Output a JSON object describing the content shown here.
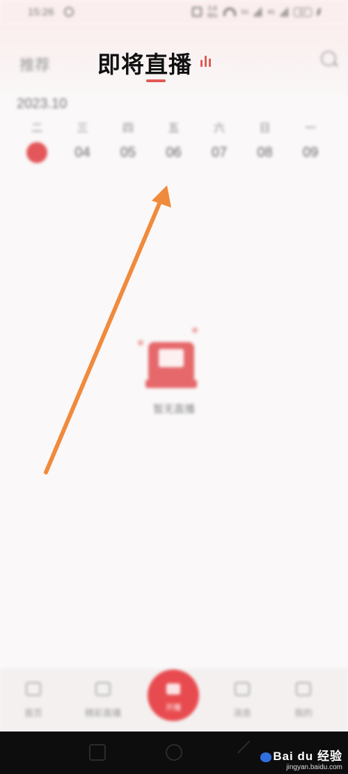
{
  "status_bar": {
    "time": "15:26",
    "net_speed_value": "5.8",
    "net_speed_unit": "M/s",
    "signal1_label": "5G",
    "signal2_label": "4G",
    "battery": "57"
  },
  "tabs": {
    "recommend_label": "推荐",
    "upcoming_label": "即将直播"
  },
  "calendar": {
    "month_label": "2023.10",
    "days": [
      {
        "weekday": "二",
        "date": "",
        "selected": true
      },
      {
        "weekday": "三",
        "date": "04",
        "selected": false
      },
      {
        "weekday": "四",
        "date": "05",
        "selected": false
      },
      {
        "weekday": "五",
        "date": "06",
        "selected": false
      },
      {
        "weekday": "六",
        "date": "07",
        "selected": false
      },
      {
        "weekday": "日",
        "date": "08",
        "selected": false
      },
      {
        "weekday": "一",
        "date": "09",
        "selected": false
      }
    ]
  },
  "empty_state": {
    "text": "暂无直播"
  },
  "bottom_nav": {
    "items": [
      {
        "label": "首页",
        "icon": "home-icon"
      },
      {
        "label": "精彩直播",
        "icon": "live-icon"
      },
      {
        "label": "开播",
        "icon": "broadcast-icon"
      },
      {
        "label": "消息",
        "icon": "message-icon"
      },
      {
        "label": "我的",
        "icon": "profile-icon"
      }
    ]
  },
  "watermark": {
    "brand": "Bai du 经验",
    "url": "jingyan.baidu.com"
  },
  "colors": {
    "accent": "#e15a55",
    "arrow": "#f08a3c"
  }
}
